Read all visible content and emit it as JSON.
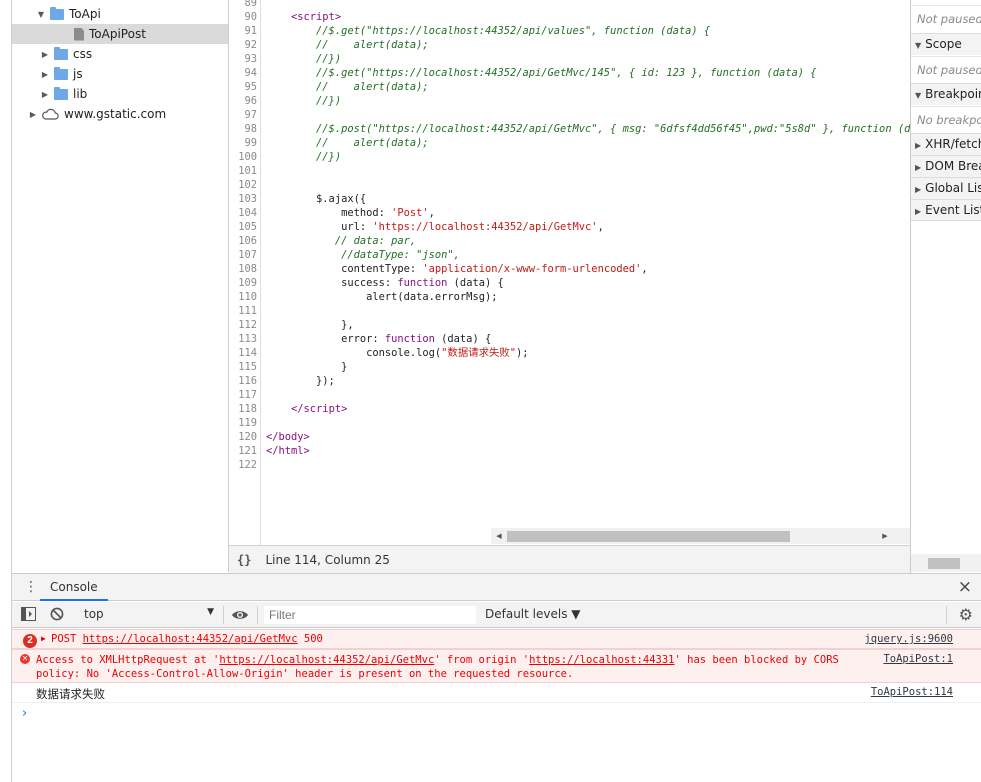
{
  "navigator": {
    "items": [
      {
        "label": "ToApi",
        "type": "folder",
        "expanded": true
      },
      {
        "label": "ToApiPost",
        "type": "file",
        "selected": true
      },
      {
        "label": "css",
        "type": "folder",
        "expanded": false
      },
      {
        "label": "js",
        "type": "folder",
        "expanded": false
      },
      {
        "label": "lib",
        "type": "folder",
        "expanded": false
      },
      {
        "label": "www.gstatic.com",
        "type": "cloud",
        "expanded": false
      }
    ]
  },
  "editor": {
    "lines": [
      {
        "n": "89",
        "html": ""
      },
      {
        "n": "90",
        "html": "    <span class=\"c-tag\">&lt;script&gt;</span>"
      },
      {
        "n": "91",
        "html": "        <span class=\"c-cm\">//$.get(\"https://localhost:44352/api/values\", function (data) {</span>"
      },
      {
        "n": "92",
        "html": "        <span class=\"c-cm\">//    alert(data);</span>"
      },
      {
        "n": "93",
        "html": "        <span class=\"c-cm\">//})</span>"
      },
      {
        "n": "94",
        "html": "        <span class=\"c-cm\">//$.get(\"https://localhost:44352/api/GetMvc/145\", { id: 123 }, function (data) {</span>"
      },
      {
        "n": "95",
        "html": "        <span class=\"c-cm\">//    alert(data);</span>"
      },
      {
        "n": "96",
        "html": "        <span class=\"c-cm\">//})</span>"
      },
      {
        "n": "97",
        "html": ""
      },
      {
        "n": "98",
        "html": "        <span class=\"c-cm\">//$.post(\"https://localhost:44352/api/GetMvc\", { msg: \"6dfsf4dd56f45\",pwd:\"5s8d\" }, function (data) {</span>"
      },
      {
        "n": "99",
        "html": "        <span class=\"c-cm\">//    alert(data);</span>"
      },
      {
        "n": "100",
        "html": "        <span class=\"c-cm\">//})</span>"
      },
      {
        "n": "101",
        "html": ""
      },
      {
        "n": "102",
        "html": ""
      },
      {
        "n": "103",
        "html": "        $.ajax({"
      },
      {
        "n": "104",
        "html": "            method: <span class=\"c-str\">'Post'</span>,"
      },
      {
        "n": "105",
        "html": "            url: <span class=\"c-str\">'https://localhost:44352/api/GetMvc'</span>,"
      },
      {
        "n": "106",
        "html": "           <span class=\"c-cm\">// data: par,</span>"
      },
      {
        "n": "107",
        "html": "            <span class=\"c-cm\">//dataType: \"json\",</span>"
      },
      {
        "n": "108",
        "html": "            contentType: <span class=\"c-str\">'application/x-www-form-urlencoded'</span>,"
      },
      {
        "n": "109",
        "html": "            success: <span class=\"c-kw\">function</span> (data) {"
      },
      {
        "n": "110",
        "html": "                alert(data.errorMsg);"
      },
      {
        "n": "111",
        "html": ""
      },
      {
        "n": "112",
        "html": "            },"
      },
      {
        "n": "113",
        "html": "            error: <span class=\"c-kw\">function</span> (data) {"
      },
      {
        "n": "114",
        "html": "                console.log(<span class=\"c-str\">\"数据请求失败\"</span>);"
      },
      {
        "n": "115",
        "html": "            }"
      },
      {
        "n": "116",
        "html": "        });"
      },
      {
        "n": "117",
        "html": ""
      },
      {
        "n": "118",
        "html": "    <span class=\"c-tag\">&lt;/script&gt;</span>"
      },
      {
        "n": "119",
        "html": ""
      },
      {
        "n": "120",
        "html": "<span class=\"c-tag\">&lt;/body&gt;</span>"
      },
      {
        "n": "121",
        "html": "<span class=\"c-tag\">&lt;/html&gt;</span>"
      },
      {
        "n": "122",
        "html": ""
      }
    ]
  },
  "status_bar": {
    "braces": "{}",
    "position": "Line 114, Column 25"
  },
  "right_panel": {
    "not_paused_1": "Not paused",
    "scope": "Scope",
    "not_paused_2": "Not paused",
    "breakpoints": "Breakpoints",
    "no_breakpoints": "No breakpoints",
    "xhr": "XHR/fetch Breakpoints",
    "dom": "DOM Breakpoints",
    "global": "Global Listeners",
    "event": "Event Listener Breakpoints"
  },
  "console": {
    "tab_label": "Console",
    "context": "top",
    "filter_placeholder": "Filter",
    "levels": "Default levels ▼",
    "messages": {
      "m1_count": "2",
      "m1_text": "POST",
      "m1_url": "https://localhost:44352/api/GetMvc",
      "m1_status": "500",
      "m1_source": "jquery.js:9600",
      "m2_prefix": "Access to XMLHttpRequest at '",
      "m2_url": "https://localhost:44352/api/GetMvc",
      "m2_mid": "' from origin '",
      "m2_origin": "https://localhost:44331",
      "m2_suffix": "' has been blocked by CORS",
      "m2_line2": "policy: No 'Access-Control-Allow-Origin' header is present on the requested resource.",
      "m2_source": "ToApiPost:1",
      "m3_text": "数据请求失败",
      "m3_source": "ToApiPost:114",
      "prompt": "›"
    }
  }
}
